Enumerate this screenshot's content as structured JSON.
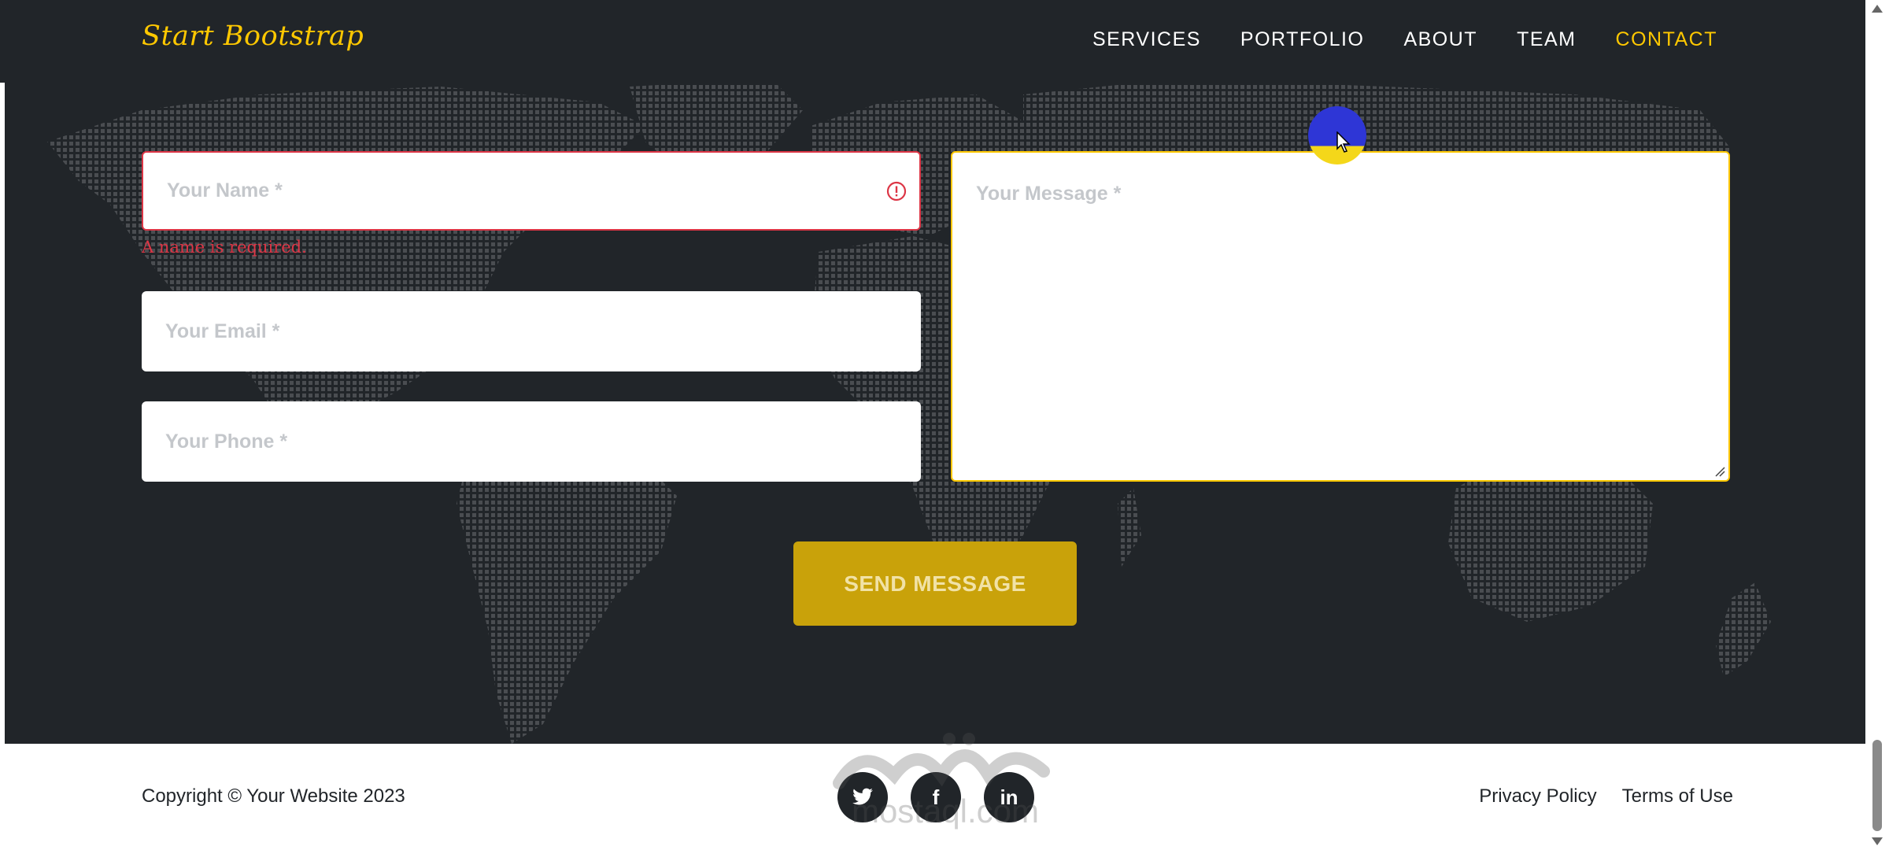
{
  "navbar": {
    "brand": "Start Bootstrap",
    "links": [
      {
        "label": "SERVICES"
      },
      {
        "label": "PORTFOLIO"
      },
      {
        "label": "ABOUT"
      },
      {
        "label": "TEAM"
      },
      {
        "label": "CONTACT"
      }
    ],
    "active_link": "CONTACT"
  },
  "form": {
    "name_placeholder": "Your Name *",
    "name_error": "A name is required.",
    "email_placeholder": "Your Email *",
    "phone_placeholder": "Your Phone *",
    "message_placeholder": "Your Message *",
    "submit_label": "SEND MESSAGE"
  },
  "footer": {
    "copyright": "Copyright © Your Website 2023",
    "social": [
      {
        "icon": "twitter-icon",
        "glyph": "🐦"
      },
      {
        "icon": "facebook-icon",
        "glyph": "f"
      },
      {
        "icon": "linkedin-icon",
        "glyph": "in"
      }
    ],
    "links": [
      {
        "label": "Privacy Policy"
      },
      {
        "label": "Terms of Use"
      }
    ]
  },
  "watermark": {
    "text": "mostaql.com"
  },
  "colors": {
    "accent": "#ffc800",
    "background": "#212529",
    "error": "#dc3545"
  }
}
